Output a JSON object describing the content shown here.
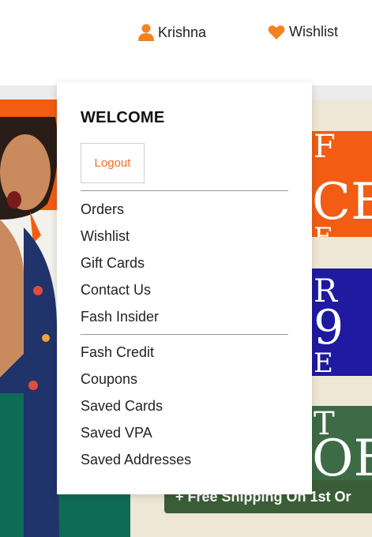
{
  "header": {
    "user_name": "Krishna",
    "wishlist_label": "Wishlist",
    "accent_color": "#f58220"
  },
  "dropdown": {
    "welcome_heading": "WELCOME",
    "logout_label": "Logout",
    "group1": [
      {
        "label": "Orders"
      },
      {
        "label": "Wishlist"
      },
      {
        "label": "Gift Cards"
      },
      {
        "label": "Contact Us"
      },
      {
        "label": "Fash Insider"
      }
    ],
    "group2": [
      {
        "label": "Fash Credit"
      },
      {
        "label": "Coupons"
      },
      {
        "label": "Saved Cards"
      },
      {
        "label": "Saved VPA"
      },
      {
        "label": "Saved Addresses"
      }
    ]
  },
  "banner": {
    "panel1_text": "F CE E",
    "panel2_text": "R 9 E",
    "panel3_text": "T OFF",
    "shipping_text": "+ Free Shipping On 1st Or",
    "colors": {
      "orange": "#f25c13",
      "blue": "#1f1aa0",
      "green": "#3d6b45",
      "teal": "#0e6b55"
    }
  }
}
